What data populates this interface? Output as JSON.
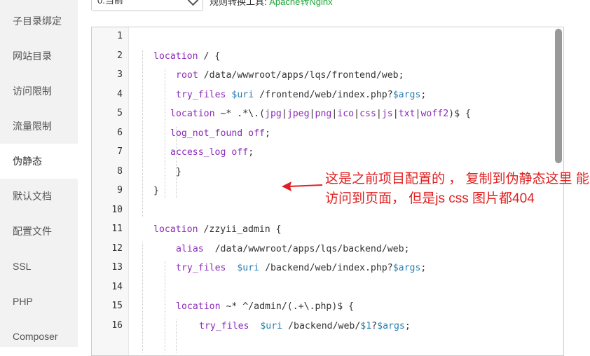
{
  "sidebar": {
    "items": [
      {
        "label": "子目录绑定",
        "active": false
      },
      {
        "label": "网站目录",
        "active": false
      },
      {
        "label": "访问限制",
        "active": false
      },
      {
        "label": "流量限制",
        "active": false
      },
      {
        "label": "伪静态",
        "active": true
      },
      {
        "label": "默认文档",
        "active": false
      },
      {
        "label": "配置文件",
        "active": false
      },
      {
        "label": "SSL",
        "active": false
      },
      {
        "label": "PHP",
        "active": false
      },
      {
        "label": "Composer",
        "active": false
      }
    ]
  },
  "rule_select": {
    "value": "0.当前"
  },
  "rule_note": {
    "prefix": "规则转换工具:",
    "link": "Apache转Nginx"
  },
  "editor": {
    "lines": [
      {
        "n": "1",
        "segs": []
      },
      {
        "n": "2",
        "segs": [
          [
            "kw",
            "location"
          ],
          [
            "t",
            " / {"
          ]
        ]
      },
      {
        "n": "3",
        "segs": [
          [
            "kw",
            "root"
          ],
          [
            "t",
            " /data/wwwroot/apps/lqs/frontend/web;"
          ]
        ]
      },
      {
        "n": "4",
        "segs": [
          [
            "kw",
            "try_files"
          ],
          [
            "t",
            " "
          ],
          [
            "vr",
            "$uri"
          ],
          [
            "t",
            " /frontend/web/index.php?"
          ],
          [
            "vr",
            "$args"
          ],
          [
            "t",
            ";"
          ]
        ]
      },
      {
        "n": "5",
        "segs": [
          [
            "kw",
            "location"
          ],
          [
            "t",
            " ~* .*\\.("
          ],
          [
            "kw",
            "jpg"
          ],
          [
            "t",
            "|"
          ],
          [
            "kw",
            "jpeg"
          ],
          [
            "t",
            "|"
          ],
          [
            "kw",
            "png"
          ],
          [
            "t",
            "|"
          ],
          [
            "kw",
            "ico"
          ],
          [
            "t",
            "|"
          ],
          [
            "kw",
            "css"
          ],
          [
            "t",
            "|"
          ],
          [
            "kw",
            "js"
          ],
          [
            "t",
            "|"
          ],
          [
            "kw",
            "txt"
          ],
          [
            "t",
            "|"
          ],
          [
            "kw",
            "woff2"
          ],
          [
            "t",
            ")$ {"
          ]
        ]
      },
      {
        "n": "6",
        "segs": [
          [
            "kw",
            "log_not_found"
          ],
          [
            "t",
            " "
          ],
          [
            "kw",
            "off"
          ],
          [
            "t",
            ";"
          ]
        ]
      },
      {
        "n": "7",
        "segs": [
          [
            "kw",
            "access_log"
          ],
          [
            "t",
            " "
          ],
          [
            "kw",
            "off"
          ],
          [
            "t",
            ";"
          ]
        ]
      },
      {
        "n": "8",
        "segs": [
          [
            "t",
            "}"
          ]
        ]
      },
      {
        "n": "9",
        "segs": [
          [
            "t",
            "}"
          ]
        ]
      },
      {
        "n": "10",
        "segs": []
      },
      {
        "n": "11",
        "segs": [
          [
            "kw",
            "location"
          ],
          [
            "t",
            " /zzyii_admin {"
          ]
        ]
      },
      {
        "n": "12",
        "segs": [
          [
            "kw",
            "alias"
          ],
          [
            "t",
            "  /data/wwwroot/apps/lqs/backend/web;"
          ]
        ]
      },
      {
        "n": "13",
        "segs": [
          [
            "kw",
            "try_files"
          ],
          [
            "t",
            "  "
          ],
          [
            "vr",
            "$uri"
          ],
          [
            "t",
            " /backend/web/index.php?"
          ],
          [
            "vr",
            "$args"
          ],
          [
            "t",
            ";"
          ]
        ]
      },
      {
        "n": "14",
        "segs": []
      },
      {
        "n": "15",
        "segs": [
          [
            "kw",
            "location"
          ],
          [
            "t",
            " ~* ^/admin/(.+\\.php)$ {"
          ]
        ]
      },
      {
        "n": "16",
        "segs": [
          [
            "kw",
            "try_files"
          ],
          [
            "t",
            "  "
          ],
          [
            "vr",
            "$uri"
          ],
          [
            "t",
            " /backend/web/"
          ],
          [
            "vr",
            "$1"
          ],
          [
            "t",
            "?"
          ],
          [
            "vr",
            "$args"
          ],
          [
            "t",
            ";"
          ]
        ]
      }
    ]
  },
  "annotation": {
    "text": "这是之前项目配置的 ， 复制到伪静态这里 能访问到页面， 但是js css 图片都404",
    "color": "#e02020"
  }
}
